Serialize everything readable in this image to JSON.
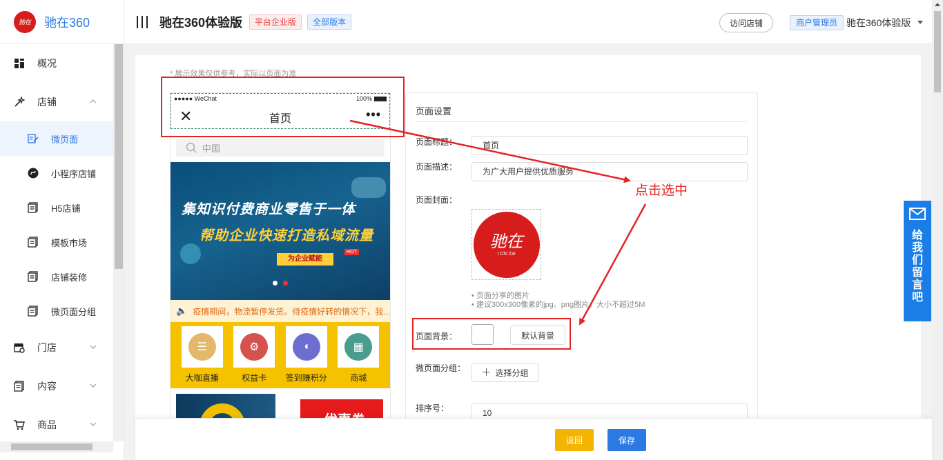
{
  "sidebar": {
    "logo_glyph": "驰在",
    "brand": "驰在360",
    "items": [
      {
        "label": "概况"
      },
      {
        "label": "店铺"
      },
      {
        "label": "微页面"
      },
      {
        "label": "小程序店铺"
      },
      {
        "label": "H5店铺"
      },
      {
        "label": "模板市场"
      },
      {
        "label": "店铺装修"
      },
      {
        "label": "微页面分组"
      },
      {
        "label": "门店"
      },
      {
        "label": "内容"
      },
      {
        "label": "商品"
      }
    ]
  },
  "header": {
    "title": "驰在360体验版",
    "tag_platform": "平台企业版",
    "tag_version": "全部版本",
    "visit_shop": "访问店铺",
    "role": "商户管理员",
    "user": "驰在360体验版"
  },
  "preview": {
    "notice": "* 展示效果仅供参考，实际以页面为准",
    "status_left": "●●●●● WeChat",
    "status_right": "100%",
    "page_title": "首页",
    "more": "•••",
    "search_placeholder": "中国",
    "banner_line1": "集知识付费商业零售于一体",
    "banner_line2": "帮助企业快速打造私域流量",
    "banner_tag": "为企业赋能",
    "banner_hot": "HOT",
    "notice_text": "疫情期间，物流暂停发货。待疫情好转的情况下，我...",
    "grid": [
      {
        "label": "大咖直播",
        "color": "#e3b86a"
      },
      {
        "label": "权益卡",
        "color": "#d4534e"
      },
      {
        "label": "签到赚积分",
        "color": "#6c6fd0"
      },
      {
        "label": "商城",
        "color": "#4a9c8e"
      }
    ],
    "promo_text": "优惠券"
  },
  "settings": {
    "section_title": "页面设置",
    "title_label": "页面标题：",
    "title_value": "首页",
    "desc_label": "页面描述：",
    "desc_value": "为广大用户提供优质服务",
    "cover_label": "页面封面：",
    "cover_logo_sub": "I Chi Zai",
    "hint1": "• 页面分享的图片",
    "hint2": "• 建议300x300像素的jpg、png图片，大小不超过5M",
    "bg_label": "页面背景：",
    "bg_default": "默认背景",
    "group_label": "微页面分组：",
    "group_button": "选择分组",
    "sort_label": "排序号：",
    "sort_value": "10"
  },
  "footer": {
    "back": "返回",
    "save": "保存"
  },
  "annotation": {
    "text": "点击选中"
  },
  "feedback": {
    "text": "给我们留言吧"
  },
  "colors": {
    "accent": "#2a7ae2",
    "annotation": "#e52222",
    "back_button": "#f5b400",
    "feedback": "#1a7ee6"
  }
}
